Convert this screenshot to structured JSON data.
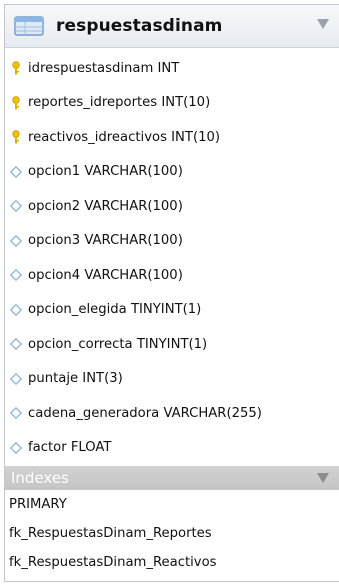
{
  "table": {
    "name": "respuestasdinam",
    "columns": [
      {
        "icon": "key-icon",
        "label": "idrespuestasdinam INT"
      },
      {
        "icon": "key-icon",
        "label": "reportes_idreportes INT(10)"
      },
      {
        "icon": "key-icon",
        "label": "reactivos_idreactivos INT(10)"
      },
      {
        "icon": "diamond-icon",
        "label": "opcion1 VARCHAR(100)"
      },
      {
        "icon": "diamond-icon",
        "label": "opcion2 VARCHAR(100)"
      },
      {
        "icon": "diamond-icon",
        "label": "opcion3 VARCHAR(100)"
      },
      {
        "icon": "diamond-icon",
        "label": "opcion4 VARCHAR(100)"
      },
      {
        "icon": "diamond-icon",
        "label": "opcion_elegida TINYINT(1)"
      },
      {
        "icon": "diamond-icon",
        "label": "opcion_correcta TINYINT(1)"
      },
      {
        "icon": "diamond-icon",
        "label": "puntaje INT(3)"
      },
      {
        "icon": "diamond-icon",
        "label": "cadena_generadora VARCHAR(255)"
      },
      {
        "icon": "diamond-icon",
        "label": "factor FLOAT"
      }
    ],
    "indexes_label": "Indexes",
    "indexes": [
      "PRIMARY",
      "fk_RespuestasDinam_Reportes",
      "fk_RespuestasDinam_Reactivos"
    ]
  },
  "colors": {
    "key": "#e8b800",
    "diamond": "#8fb3d3",
    "header_icon": "#6e9fd4"
  }
}
